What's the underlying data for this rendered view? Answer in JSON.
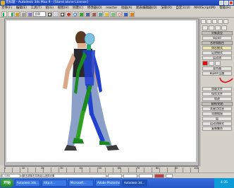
{
  "window": {
    "title": "无标题 - Autodesk 3ds Max 9 - [Stand alone License]"
  },
  "menu": [
    "文件(F)",
    "编辑(E)",
    "工具(T)",
    "组(G)",
    "视图(V)",
    "创建(C)",
    "修改器(O)",
    "reactor",
    "动画(A)",
    "图表编辑器(D)",
    "渲染(R)",
    "自定义(U)",
    "MAXScript(M)",
    "帮助(H)"
  ],
  "toolbar": {
    "selection_filter": "全部"
  },
  "command_panel": {
    "rollouts": [
      "对象类型",
      "名称和颜色",
      "Biped",
      "创建方法"
    ],
    "buttons": [
      "体形模式",
      "足迹模式",
      "运动流",
      "混合器",
      "Biped 回放",
      "加载文件",
      "保存文件",
      "轨迹",
      "复制/粘贴",
      "关键点信息",
      "弯曲链接",
      "层",
      "运动流模式",
      "复制集合"
    ],
    "selected_button": "体形模式"
  },
  "timeline": {
    "frame_counter": "0 / 100",
    "ticks": [
      "0",
      "10",
      "20",
      "30",
      "40",
      "50",
      "60",
      "70",
      "80",
      "90",
      "100"
    ]
  },
  "statusbar": {
    "prompt": "单击或单击并拖动以选择对象"
  },
  "taskbar": {
    "start_label": "开始",
    "tasks": [
      "Autodesk 3ds...",
      "http://...",
      "Microsoft...",
      "Adobe Photoshop",
      "Autodesk 3d..."
    ],
    "tray_time": "4:35"
  },
  "colors": {
    "accent_red": "#e01010",
    "biped_blue": "#2040d0",
    "biped_green": "#30a020",
    "biped_cyan": "#40a8c8"
  }
}
